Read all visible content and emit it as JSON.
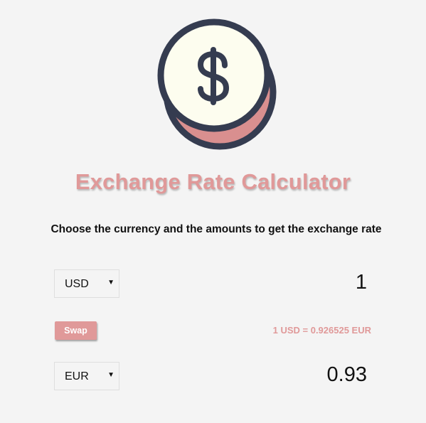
{
  "header": {
    "logo_icon": "dollar-coin-icon",
    "title": "Exchange Rate Calculator",
    "subtitle": "Choose the currency and the amounts to get the exchange rate"
  },
  "colors": {
    "accent": "#e09999",
    "coin_face": "#fdfdef",
    "coin_outline": "#353c50",
    "background": "#f4f4f4"
  },
  "currency_one": {
    "selected": "USD",
    "amount": "1"
  },
  "swap": {
    "label": "Swap"
  },
  "rate": {
    "text": "1 USD = 0.926525 EUR"
  },
  "currency_two": {
    "selected": "EUR",
    "amount": "0.93"
  }
}
